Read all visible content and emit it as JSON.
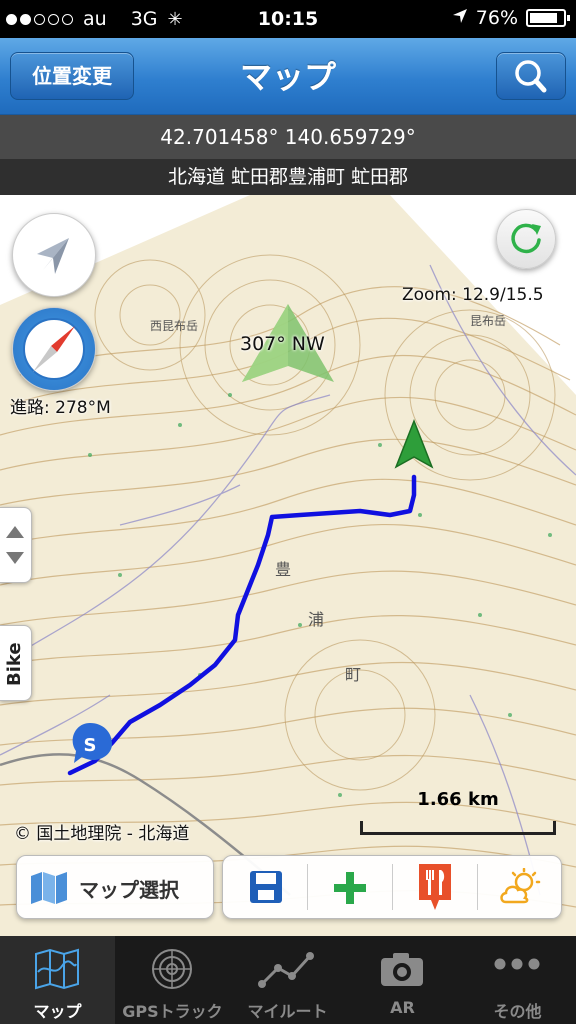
{
  "status": {
    "carrier": "au",
    "network": "3G",
    "time": "10:15",
    "battery": "76%"
  },
  "navbar": {
    "title": "マップ",
    "left_button": "位置変更"
  },
  "location": {
    "coords": "42.701458° 140.659729°",
    "address": "北海道 虻田郡豊浦町 虻田郡"
  },
  "map": {
    "zoom": "Zoom: 12.9/15.5",
    "heading": "307° NW",
    "course": "進路: 278°M",
    "scale": "1.66 km",
    "copyright": "© 国土地理院 - 北海道",
    "side_tab_label": "Bike",
    "start_marker": "S"
  },
  "toolbar": {
    "map_select": "マップ選択"
  },
  "tabs": [
    {
      "label": "マップ"
    },
    {
      "label": "GPSトラック"
    },
    {
      "label": "マイルート"
    },
    {
      "label": "AR"
    },
    {
      "label": "その他"
    }
  ],
  "colors": {
    "accent": "#2f7fcf",
    "track": "#1010e0",
    "save": "#1f5fb8",
    "add": "#2aa84a",
    "food": "#e8502a",
    "weather": "#f2a81e"
  }
}
